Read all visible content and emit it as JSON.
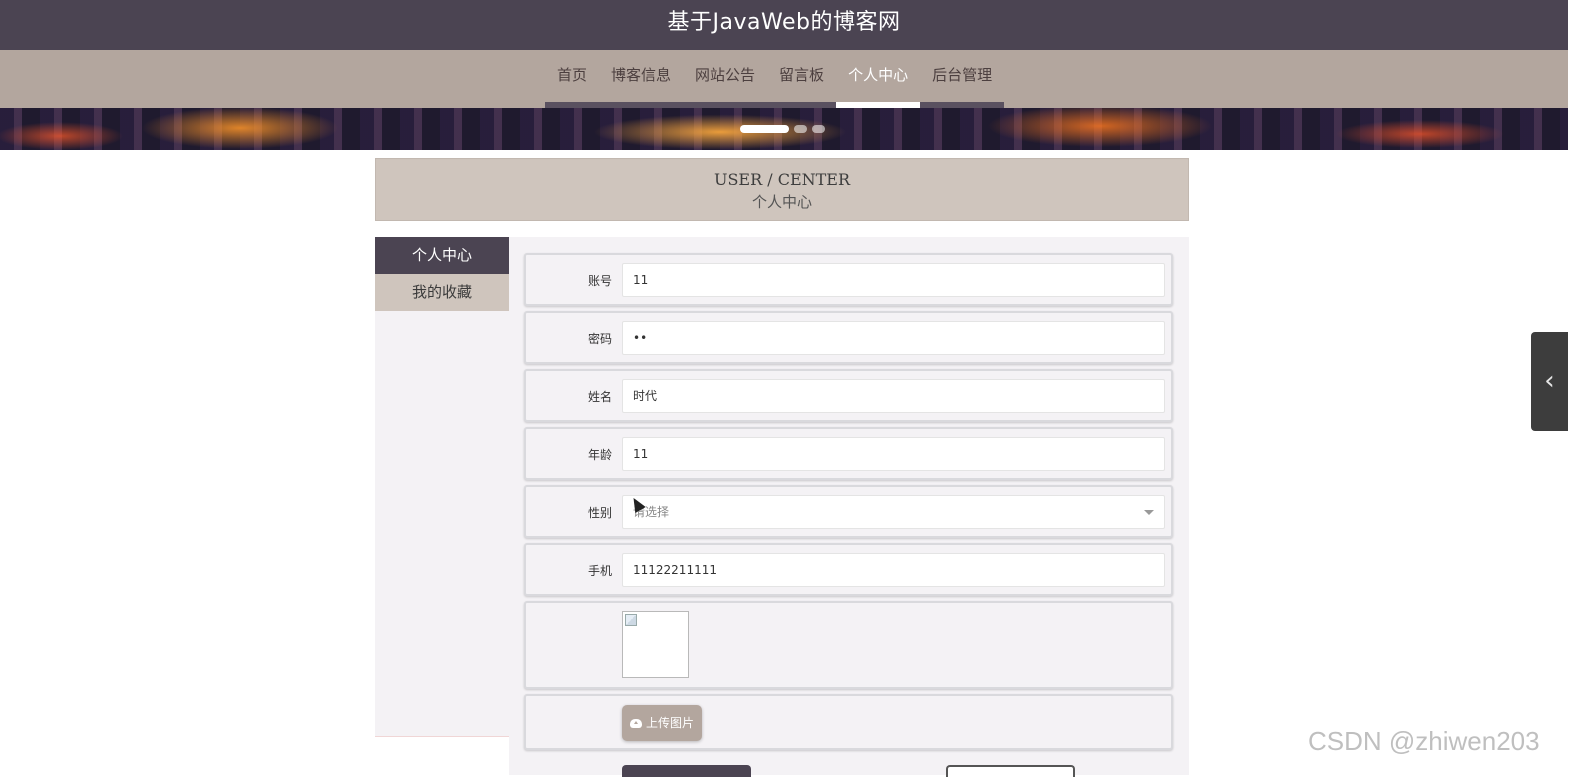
{
  "header": {
    "site_title": "基于JavaWeb的博客网"
  },
  "nav": {
    "items": [
      {
        "label": "首页",
        "active": false
      },
      {
        "label": "博客信息",
        "active": false
      },
      {
        "label": "网站公告",
        "active": false
      },
      {
        "label": "留言板",
        "active": false
      },
      {
        "label": "个人中心",
        "active": true
      },
      {
        "label": "后台管理",
        "active": false
      }
    ]
  },
  "banner": {
    "active_slide": 1,
    "slide_count": 3
  },
  "section": {
    "title_en": "USER / CENTER",
    "title_cn": "个人中心"
  },
  "sidebar": {
    "items": [
      {
        "label": "个人中心",
        "active": true
      },
      {
        "label": "我的收藏",
        "active": false
      }
    ]
  },
  "form": {
    "account": {
      "label": "账号",
      "value": "11"
    },
    "password": {
      "label": "密码",
      "value": "••"
    },
    "name": {
      "label": "姓名",
      "value": "时代"
    },
    "age": {
      "label": "年龄",
      "value": "11"
    },
    "gender": {
      "label": "性别",
      "placeholder": "请选择"
    },
    "phone": {
      "label": "手机",
      "value": "11122211111"
    },
    "upload_label": "上传图片"
  },
  "side_toggle": {
    "glyph": "‹"
  },
  "watermark": "CSDN @zhiwen203",
  "colors": {
    "header": "#4b4452",
    "nav": "#b3a69e",
    "section": "#cfc5bd"
  }
}
